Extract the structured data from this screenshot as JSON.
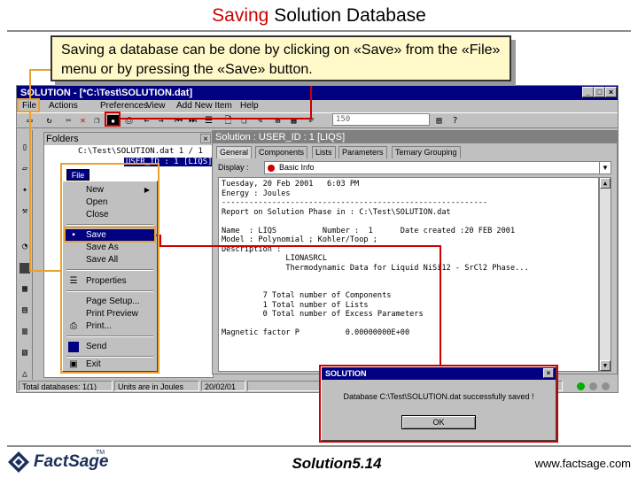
{
  "slide": {
    "title_highlight": "Saving",
    "title_rest": " Solution Database",
    "callout": "Saving a database can be done by clicking on «Save» from the «File» menu or by pressing the «Save» button."
  },
  "window": {
    "title": "SOLUTION - [*C:\\Test\\SOLUTION.dat]",
    "menu": [
      "File",
      "Actions",
      "Preferences",
      "View",
      "Add New Item",
      "Help"
    ],
    "combo_value": "150"
  },
  "folders": {
    "header": "Folders",
    "tree_path": "C:\\Test\\SOLUTION.dat 1 / 1",
    "tree_selected": "USER_ID : 1 [LIQS]"
  },
  "file_menu": {
    "label": "File",
    "items": {
      "new": "New",
      "open": "Open",
      "close": "Close",
      "save": "Save",
      "save_as": "Save As",
      "save_all": "Save All",
      "properties": "Properties",
      "page_setup": "Page Setup...",
      "print_preview": "Print Preview",
      "print": "Print...",
      "send": "Send",
      "exit": "Exit"
    }
  },
  "solution_panel": {
    "header": "Solution : USER_ID : 1 [LIQS]",
    "tabs": [
      "General",
      "Components",
      "Lists",
      "Parameters",
      "Ternary Grouping"
    ],
    "display_label": "Display :",
    "display_value": "Basic Info",
    "report": "Tuesday, 20 Feb 2001   6:03 PM\nEnergy : Joules\n----------------------------------------------------------\nReport on Solution Phase in : C:\\Test\\SOLUTION.dat\n\nName  : LIQS          Number :  1      Date created :20 FEB 2001\nModel : Polynomial ; Kohler/Toop ;\nDescription :\n              LIONASRCL\n              Thermodynamic Data for Liquid NiSi12 - SrCl2 Phase...\n\n\n         7 Total number of Components\n         1 Total number of Lists\n         0 Total number of Excess Parameters\n\nMagnetic factor P          0.00000000E+00"
  },
  "statusbar": {
    "total": "Total databases: 1(1)",
    "units": "Units are in Joules",
    "date": "20/02/01"
  },
  "dialog": {
    "title": "SOLUTION",
    "message": "Database C:\\Test\\SOLUTION.dat successfully saved !",
    "ok": "OK"
  },
  "footer": {
    "logo": "FactSage",
    "logo_tm": "TM",
    "center": "Solution5.14",
    "url": "www.factsage.com"
  }
}
